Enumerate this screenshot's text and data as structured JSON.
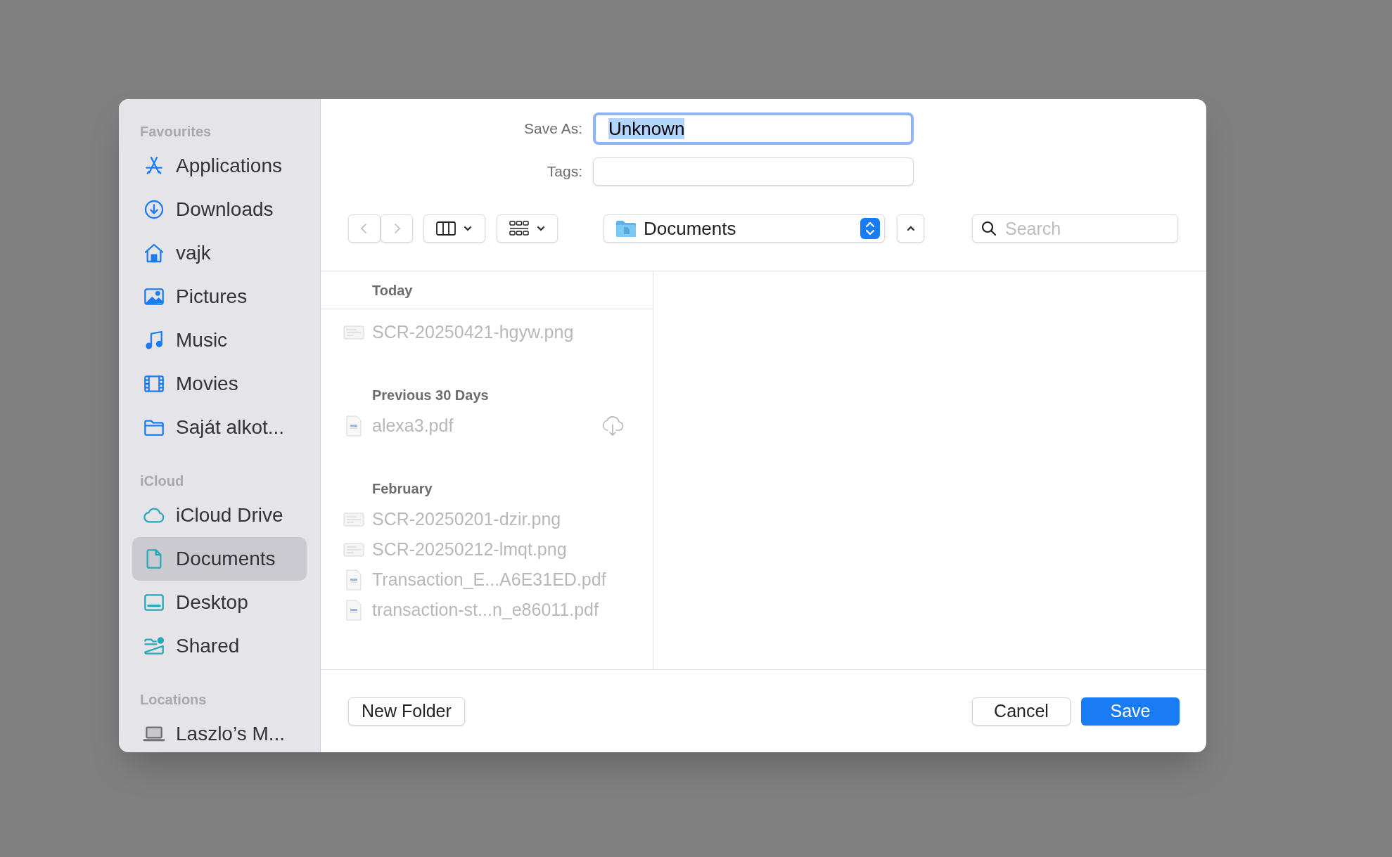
{
  "sidebar": {
    "sections": [
      {
        "title": "Favourites",
        "items": [
          {
            "kind": "applications",
            "label": "Applications",
            "selected": false
          },
          {
            "kind": "downloads",
            "label": "Downloads",
            "selected": false
          },
          {
            "kind": "home",
            "label": "vajk",
            "selected": false
          },
          {
            "kind": "pictures",
            "label": "Pictures",
            "selected": false
          },
          {
            "kind": "music",
            "label": "Music",
            "selected": false
          },
          {
            "kind": "movies",
            "label": "Movies",
            "selected": false
          },
          {
            "kind": "folder",
            "label": "Saját alkot...",
            "selected": false
          }
        ]
      },
      {
        "title": "iCloud",
        "items": [
          {
            "kind": "cloud",
            "label": "iCloud Drive",
            "selected": false
          },
          {
            "kind": "document",
            "label": "Documents",
            "selected": true
          },
          {
            "kind": "desktop",
            "label": "Desktop",
            "selected": false
          },
          {
            "kind": "shared",
            "label": "Shared",
            "selected": false
          }
        ]
      },
      {
        "title": "Locations",
        "items": [
          {
            "kind": "laptop",
            "label": "Laszlo’s M...",
            "selected": false
          }
        ]
      }
    ]
  },
  "save_as": {
    "label": "Save As:",
    "value": "Unknown",
    "focused": true
  },
  "tags": {
    "label": "Tags:"
  },
  "toolbar": {
    "back_disabled": true,
    "forward_disabled": true,
    "location": "Documents",
    "search": {
      "placeholder": "Search"
    }
  },
  "file_list": {
    "groups": [
      {
        "title": "Today",
        "files": [
          {
            "kind": "image",
            "name": "SCR-20250421-hgyw.png",
            "disabled": true,
            "in_cloud": false
          }
        ]
      },
      {
        "title": "Previous 30 Days",
        "files": [
          {
            "kind": "pdf",
            "name": "alexa3.pdf",
            "disabled": true,
            "in_cloud": true
          }
        ]
      },
      {
        "title": "February",
        "files": [
          {
            "kind": "image",
            "name": "SCR-20250201-dzir.png",
            "disabled": true,
            "in_cloud": false
          },
          {
            "kind": "image",
            "name": "SCR-20250212-lmqt.png",
            "disabled": true,
            "in_cloud": false
          },
          {
            "kind": "pdf",
            "name": "Transaction_E...A6E31ED.pdf",
            "disabled": true,
            "in_cloud": false
          },
          {
            "kind": "pdf",
            "name": "transaction-st...n_e86011.pdf",
            "disabled": true,
            "in_cloud": false
          }
        ]
      }
    ]
  },
  "footer": {
    "new_folder": "New Folder",
    "buttons": [
      {
        "kind": "normal",
        "label": "Cancel"
      },
      {
        "kind": "default",
        "label": "Save"
      }
    ]
  }
}
